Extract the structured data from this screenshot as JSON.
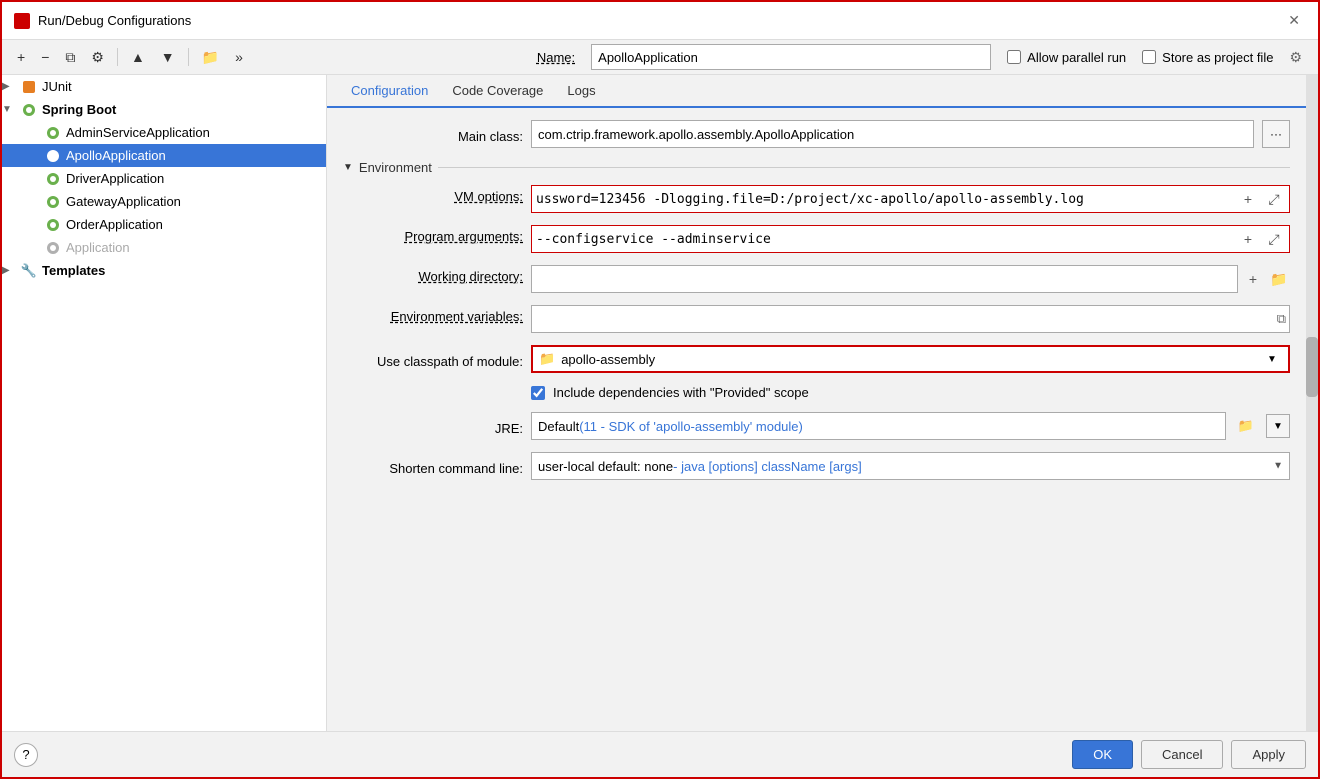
{
  "dialog": {
    "title": "Run/Debug Configurations",
    "close_label": "✕"
  },
  "toolbar": {
    "add_label": "+",
    "remove_label": "−",
    "copy_label": "⧉",
    "settings_label": "⚙",
    "move_up_label": "▲",
    "move_down_label": "▼",
    "folder_label": "📁",
    "more_label": "»"
  },
  "name_row": {
    "label": "Name:",
    "value": "ApolloApplication",
    "allow_parallel_run": "Allow parallel run",
    "store_as_project_file": "Store as project file"
  },
  "tree": {
    "junit_label": "JUnit",
    "spring_boot_label": "Spring Boot",
    "items": [
      {
        "label": "AdminServiceApplication",
        "level": "grandchild",
        "selected": false
      },
      {
        "label": "ApolloApplication",
        "level": "grandchild",
        "selected": true
      },
      {
        "label": "DriverApplication",
        "level": "grandchild",
        "selected": false
      },
      {
        "label": "GatewayApplication",
        "level": "grandchild",
        "selected": false
      },
      {
        "label": "OrderApplication",
        "level": "grandchild",
        "selected": false
      },
      {
        "label": "Application",
        "level": "grandchild",
        "selected": false,
        "disabled": true
      }
    ],
    "templates_label": "Templates"
  },
  "tabs": [
    {
      "label": "Configuration",
      "active": true
    },
    {
      "label": "Code Coverage",
      "active": false
    },
    {
      "label": "Logs",
      "active": false
    }
  ],
  "config": {
    "main_class_label": "Main class:",
    "main_class_value": "com.ctrip.framework.apollo.assembly.ApolloApplication",
    "environment_section": "Environment",
    "vm_options_label": "VM options:",
    "vm_options_value": "ussword=123456 -Dlogging.file=D:/project/xc-apollo/apollo-assembly.log",
    "program_args_label": "Program arguments:",
    "program_args_value": "--configservice --adminservice",
    "working_dir_label": "Working directory:",
    "working_dir_value": "",
    "env_vars_label": "Environment variables:",
    "env_vars_value": "",
    "use_classpath_label": "Use classpath of module:",
    "use_classpath_value": "apollo-assembly",
    "include_deps_label": "Include dependencies with \"Provided\" scope",
    "jre_label": "JRE:",
    "jre_value_default": "Default",
    "jre_value_hint": " (11 - SDK of 'apollo-assembly' module)",
    "shorten_cmd_label": "Shorten command line:",
    "shorten_cmd_value": "user-local default: none",
    "shorten_cmd_hint": " - java [options] className [args]"
  },
  "bottom": {
    "help_label": "?",
    "ok_label": "OK",
    "cancel_label": "Cancel",
    "apply_label": "Apply"
  }
}
